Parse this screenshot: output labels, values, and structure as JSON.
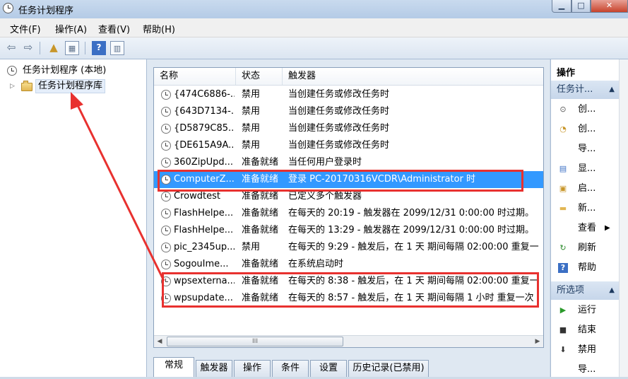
{
  "window": {
    "title": "任务计划程序"
  },
  "menubar": {
    "file": "文件(F)",
    "action": "操作(A)",
    "view": "查看(V)",
    "help": "帮助(H)"
  },
  "tree": {
    "root": "任务计划程序 (本地)",
    "library": "任务计划程序库"
  },
  "list": {
    "columns": {
      "name": "名称",
      "status": "状态",
      "trigger": "触发器"
    },
    "rows": [
      {
        "name": "{474C6886-...",
        "status": "禁用",
        "trigger": "当创建任务或修改任务时"
      },
      {
        "name": "{643D7134-...",
        "status": "禁用",
        "trigger": "当创建任务或修改任务时"
      },
      {
        "name": "{D5879C85...",
        "status": "禁用",
        "trigger": "当创建任务或修改任务时"
      },
      {
        "name": "{DE615A9A...",
        "status": "禁用",
        "trigger": "当创建任务或修改任务时"
      },
      {
        "name": "360ZipUpd...",
        "status": "准备就绪",
        "trigger": "当任何用户登录时"
      },
      {
        "name": "ComputerZ...",
        "status": "准备就绪",
        "trigger": "登录 PC-20170316VCDR\\Administrator 时"
      },
      {
        "name": "Crowdtest",
        "status": "准备就绪",
        "trigger": "已定义多个触发器"
      },
      {
        "name": "FlashHelpe...",
        "status": "准备就绪",
        "trigger": "在每天的 20:19 - 触发器在 2099/12/31 0:00:00 时过期。"
      },
      {
        "name": "FlashHelpe...",
        "status": "准备就绪",
        "trigger": "在每天的 13:29 - 触发器在 2099/12/31 0:00:00 时过期。"
      },
      {
        "name": "pic_2345up...",
        "status": "禁用",
        "trigger": "在每天的 9:29 - 触发后，在 1 天 期间每隔 02:00:00 重复一"
      },
      {
        "name": "SogouIme...",
        "status": "准备就绪",
        "trigger": "在系统启动时"
      },
      {
        "name": "wpsexterna...",
        "status": "准备就绪",
        "trigger": "在每天的 8:38 - 触发后，在 1 天 期间每隔 02:00:00 重复一"
      },
      {
        "name": "wpsupdate...",
        "status": "准备就绪",
        "trigger": "在每天的 8:57 - 触发后，在 1 天 期间每隔 1 小时 重复一次"
      }
    ],
    "selected_index": 5,
    "hscroll_thumb": "III"
  },
  "tabs": [
    "常规",
    "触发器",
    "操作",
    "条件",
    "设置",
    "历史记录(已禁用)"
  ],
  "actions": {
    "header": "操作",
    "section1": "任务计...",
    "items1": [
      {
        "label": "创...",
        "icon": "create-basic-task-icon"
      },
      {
        "label": "创...",
        "icon": "create-task-icon"
      },
      {
        "label": "导...",
        "icon": "import-icon"
      },
      {
        "label": "显...",
        "icon": "display-running-icon"
      },
      {
        "label": "启...",
        "icon": "enable-history-icon"
      },
      {
        "label": "新...",
        "icon": "new-folder-icon"
      },
      {
        "label": "查看",
        "icon": "view-icon"
      },
      {
        "label": "刷新",
        "icon": "refresh-icon"
      },
      {
        "label": "帮助",
        "icon": "help-icon"
      }
    ],
    "section2": "所选项",
    "items2": [
      {
        "label": "运行",
        "icon": "run-icon"
      },
      {
        "label": "结束",
        "icon": "end-icon"
      },
      {
        "label": "禁用",
        "icon": "disable-icon"
      },
      {
        "label": "导...",
        "icon": "export-icon"
      }
    ]
  },
  "colors": {
    "selection": "#3399ff",
    "annotation": "#e8312f"
  }
}
